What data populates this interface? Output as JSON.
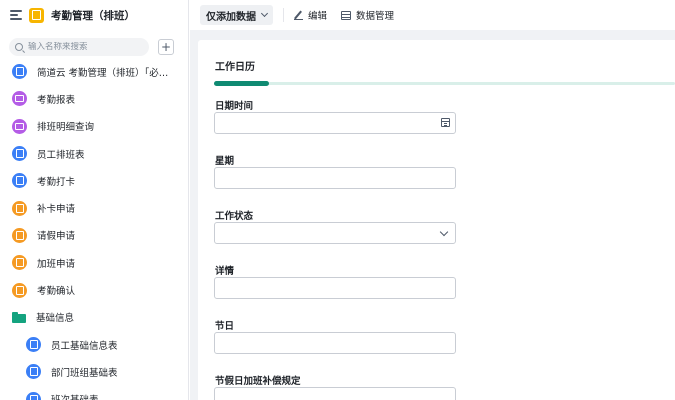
{
  "app": {
    "title": "考勤管理（排班）"
  },
  "sidebar": {
    "search_placeholder": "输入名称来搜索",
    "add_label": "+",
    "items": [
      {
        "label": "简道云 考勤管理（排班）「必…",
        "icon": "form-icon",
        "type": "form",
        "child": false
      },
      {
        "label": "考勤报表",
        "icon": "report-icon",
        "type": "report",
        "child": false
      },
      {
        "label": "排班明细查询",
        "icon": "report-icon",
        "type": "report",
        "child": false
      },
      {
        "label": "员工排班表",
        "icon": "form-icon",
        "type": "form",
        "child": false
      },
      {
        "label": "考勤打卡",
        "icon": "form-icon",
        "type": "form",
        "child": false
      },
      {
        "label": "补卡申请",
        "icon": "flow-form-icon",
        "type": "flow",
        "child": false
      },
      {
        "label": "请假申请",
        "icon": "flow-form-icon",
        "type": "flow",
        "child": false
      },
      {
        "label": "加班申请",
        "icon": "flow-form-icon",
        "type": "flow",
        "child": false
      },
      {
        "label": "考勤确认",
        "icon": "flow-form-icon",
        "type": "flow",
        "child": false
      },
      {
        "label": "基础信息",
        "icon": "folder-icon",
        "type": "folder",
        "child": false
      },
      {
        "label": "员工基础信息表",
        "icon": "form-icon",
        "type": "form",
        "child": true
      },
      {
        "label": "部门班组基础表",
        "icon": "form-icon",
        "type": "form",
        "child": true
      },
      {
        "label": "班次基础表",
        "icon": "form-icon",
        "type": "form",
        "child": true
      }
    ]
  },
  "toolbar": {
    "filter_label": "仅添加数据",
    "edit_label": "编辑",
    "data_manage_label": "数据管理"
  },
  "form": {
    "tab_title": "工作日历",
    "fields": [
      {
        "label": "日期时间",
        "kind": "date",
        "value": ""
      },
      {
        "label": "星期",
        "kind": "text",
        "value": ""
      },
      {
        "label": "工作状态",
        "kind": "select",
        "value": ""
      },
      {
        "label": "详情",
        "kind": "text",
        "value": ""
      },
      {
        "label": "节日",
        "kind": "text",
        "value": ""
      },
      {
        "label": "节假日加班补偿规定",
        "kind": "text",
        "value": ""
      }
    ]
  },
  "colors": {
    "accent": "#0f8a72",
    "form_icon": "#3b7ff6",
    "report_icon": "#b45ce6",
    "flow_icon": "#f59a23",
    "folder_icon": "#14a37f",
    "app_icon": "#f7b500"
  }
}
